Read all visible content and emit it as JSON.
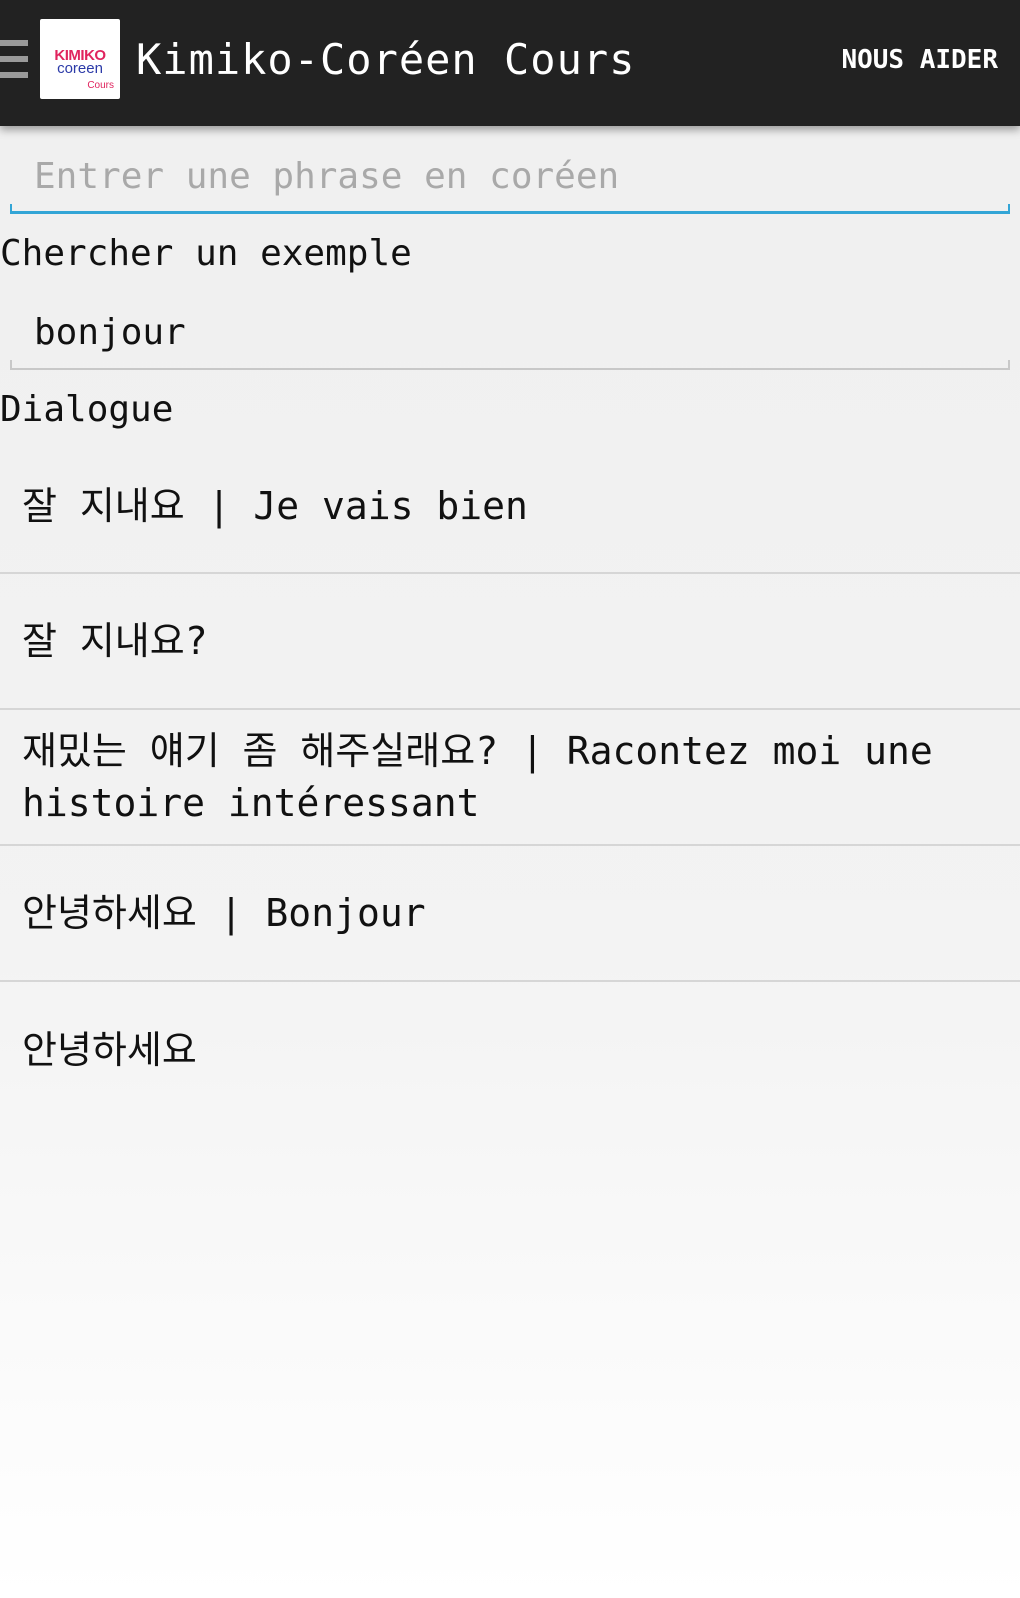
{
  "app": {
    "title": "Kimiko-Coréen Cours",
    "help_label": "NOUS AIDER",
    "logo": {
      "line1": "KIMIKO",
      "line2": "coreen",
      "line3": "Cours"
    },
    "drawer_icon": "hamburger-menu-icon"
  },
  "input": {
    "placeholder": "Entrer une phrase en coréen",
    "value": ""
  },
  "search": {
    "label": "Chercher un exemple",
    "value": "bonjour"
  },
  "dialogue": {
    "label": "Dialogue",
    "items": [
      "잘 지내요 | Je vais bien",
      "잘 지내요?",
      "재밌는 얘기 좀 해주실래요? | Racontez moi une histoire intéressant",
      "안녕하세요 | Bonjour",
      "안녕하세요"
    ]
  },
  "colors": {
    "actionbar": "#222222",
    "accent": "#33a5d6",
    "logo_red": "#e0245e",
    "logo_blue": "#2b3aa8"
  }
}
